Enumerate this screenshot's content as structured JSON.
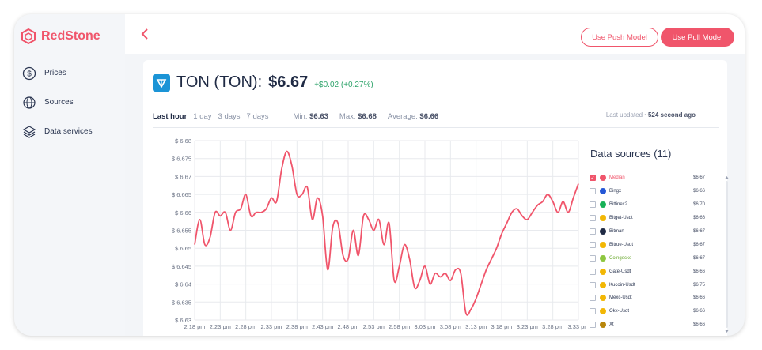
{
  "brand": {
    "name": "RedStone",
    "accent": "#f0556b"
  },
  "sidebar": {
    "items": [
      {
        "label": "Prices",
        "icon": "dollar-circle-icon"
      },
      {
        "label": "Sources",
        "icon": "globe-icon"
      },
      {
        "label": "Data services",
        "icon": "layers-icon"
      }
    ]
  },
  "topbar": {
    "push_label": "Use Push Model",
    "pull_label": "Use Pull Model"
  },
  "token": {
    "name": "TON (TON):",
    "price": "$6.67",
    "change": "+$0.02 (+0.27%)"
  },
  "filters": {
    "ranges": [
      "Last hour",
      "1 day",
      "3 days",
      "7 days"
    ],
    "active": "Last hour",
    "min_label": "Min:",
    "min_value": "$6.63",
    "max_label": "Max:",
    "max_value": "$6.68",
    "avg_label": "Average:",
    "avg_value": "$6.66"
  },
  "updated": {
    "prefix": "Last updated ",
    "value": "~524 second ago"
  },
  "data_sources": {
    "title": "Data sources (11)",
    "items": [
      {
        "name": "Median",
        "value": "$6.67",
        "checked": true,
        "color": "#f0556b"
      },
      {
        "name": "Bingx",
        "value": "$6.66",
        "checked": false,
        "color": "#2457d6"
      },
      {
        "name": "Bitfinex2",
        "value": "$6.70",
        "checked": false,
        "color": "#16b157"
      },
      {
        "name": "Bitget-Usdt",
        "value": "$6.66",
        "checked": false,
        "color": "#f2b705"
      },
      {
        "name": "Bitmart",
        "value": "$6.67",
        "checked": false,
        "color": "#1f2a44"
      },
      {
        "name": "Bitrue-Usdt",
        "value": "$6.67",
        "checked": false,
        "color": "#f2b705"
      },
      {
        "name": "Coingecko",
        "value": "$6.67",
        "checked": false,
        "color": "#8dc63f"
      },
      {
        "name": "Gate-Usdt",
        "value": "$6.66",
        "checked": false,
        "color": "#f2b705"
      },
      {
        "name": "Kucoin-Usdt",
        "value": "$6.75",
        "checked": false,
        "color": "#f2b705"
      },
      {
        "name": "Mexc-Usdt",
        "value": "$6.66",
        "checked": false,
        "color": "#f2b705"
      },
      {
        "name": "Okx-Usdt",
        "value": "$6.66",
        "checked": false,
        "color": "#f2b705"
      },
      {
        "name": "Xt",
        "value": "$6.66",
        "checked": false,
        "color": "#b8860b"
      }
    ]
  },
  "chart_data": {
    "type": "line",
    "color": "#f0556b",
    "ylim": [
      6.63,
      6.68
    ],
    "y_ticks": [
      "$ 6.68",
      "$ 6.675",
      "$ 6.67",
      "$ 6.665",
      "$ 6.66",
      "$ 6.655",
      "$ 6.65",
      "$ 6.645",
      "$ 6.64",
      "$ 6.635",
      "$ 6.63"
    ],
    "x_ticks": [
      "2:18 pm",
      "2:23 pm",
      "2:28 pm",
      "2:33 pm",
      "2:38 pm",
      "2:43 pm",
      "2:48 pm",
      "2:53 pm",
      "2:58 pm",
      "3:03 pm",
      "3:08 pm",
      "3:13 pm",
      "3:18 pm",
      "3:23 pm",
      "3:28 pm",
      "3:33 pm"
    ],
    "x_range": [
      0,
      75
    ],
    "grid": true,
    "series": [
      {
        "x": [
          0,
          1,
          2,
          3,
          4,
          5,
          6,
          7,
          8,
          9,
          10,
          11,
          12,
          13,
          14,
          15,
          16,
          17,
          18,
          19,
          20,
          21,
          22,
          23,
          24,
          25,
          26,
          27,
          28,
          29,
          30,
          31,
          32,
          33,
          34,
          35,
          36,
          37,
          38,
          39,
          40,
          41,
          42,
          43,
          44,
          45,
          46,
          47,
          48,
          49,
          50,
          51,
          52,
          53,
          54,
          55,
          56,
          57,
          58,
          59,
          60,
          61,
          62,
          63,
          64,
          65,
          66,
          67,
          68,
          69,
          70,
          71,
          72,
          73,
          74,
          75
        ],
        "y": [
          6.651,
          6.658,
          6.651,
          6.653,
          6.66,
          6.659,
          6.66,
          6.655,
          6.66,
          6.661,
          6.665,
          6.659,
          6.66,
          6.66,
          6.661,
          6.664,
          6.663,
          6.672,
          6.677,
          6.673,
          6.665,
          6.665,
          6.667,
          6.658,
          6.664,
          6.659,
          6.644,
          6.656,
          6.657,
          6.648,
          6.647,
          6.655,
          6.648,
          6.659,
          6.658,
          6.655,
          6.658,
          6.651,
          6.657,
          6.641,
          6.645,
          6.651,
          6.647,
          6.639,
          6.641,
          6.645,
          6.64,
          6.643,
          6.642,
          6.643,
          6.641,
          6.644,
          6.643,
          6.632,
          6.633,
          6.636,
          6.64,
          6.644,
          6.647,
          6.65,
          6.654,
          6.657,
          6.66,
          6.661,
          6.659,
          6.658,
          6.66,
          6.662,
          6.663,
          6.665,
          6.663,
          6.66,
          6.663,
          6.66,
          6.664,
          6.668
        ]
      }
    ]
  }
}
